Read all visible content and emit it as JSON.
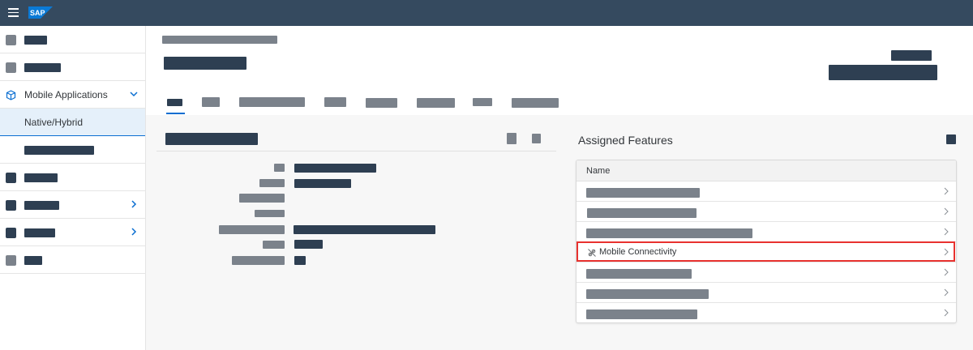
{
  "shell": {
    "menu_icon": "hamburger-menu-icon",
    "logo_text": "SAP",
    "colors": {
      "shellbar": "#354a5f",
      "accent": "#0a6ed1",
      "highlight": "#e8322f"
    }
  },
  "sidebar": {
    "active_group": "Mobile Applications",
    "selected_item": "Native/Hybrid"
  },
  "assigned_features": {
    "title": "Assigned Features",
    "column_name": "Name",
    "highlighted_row": "Mobile Connectivity"
  }
}
